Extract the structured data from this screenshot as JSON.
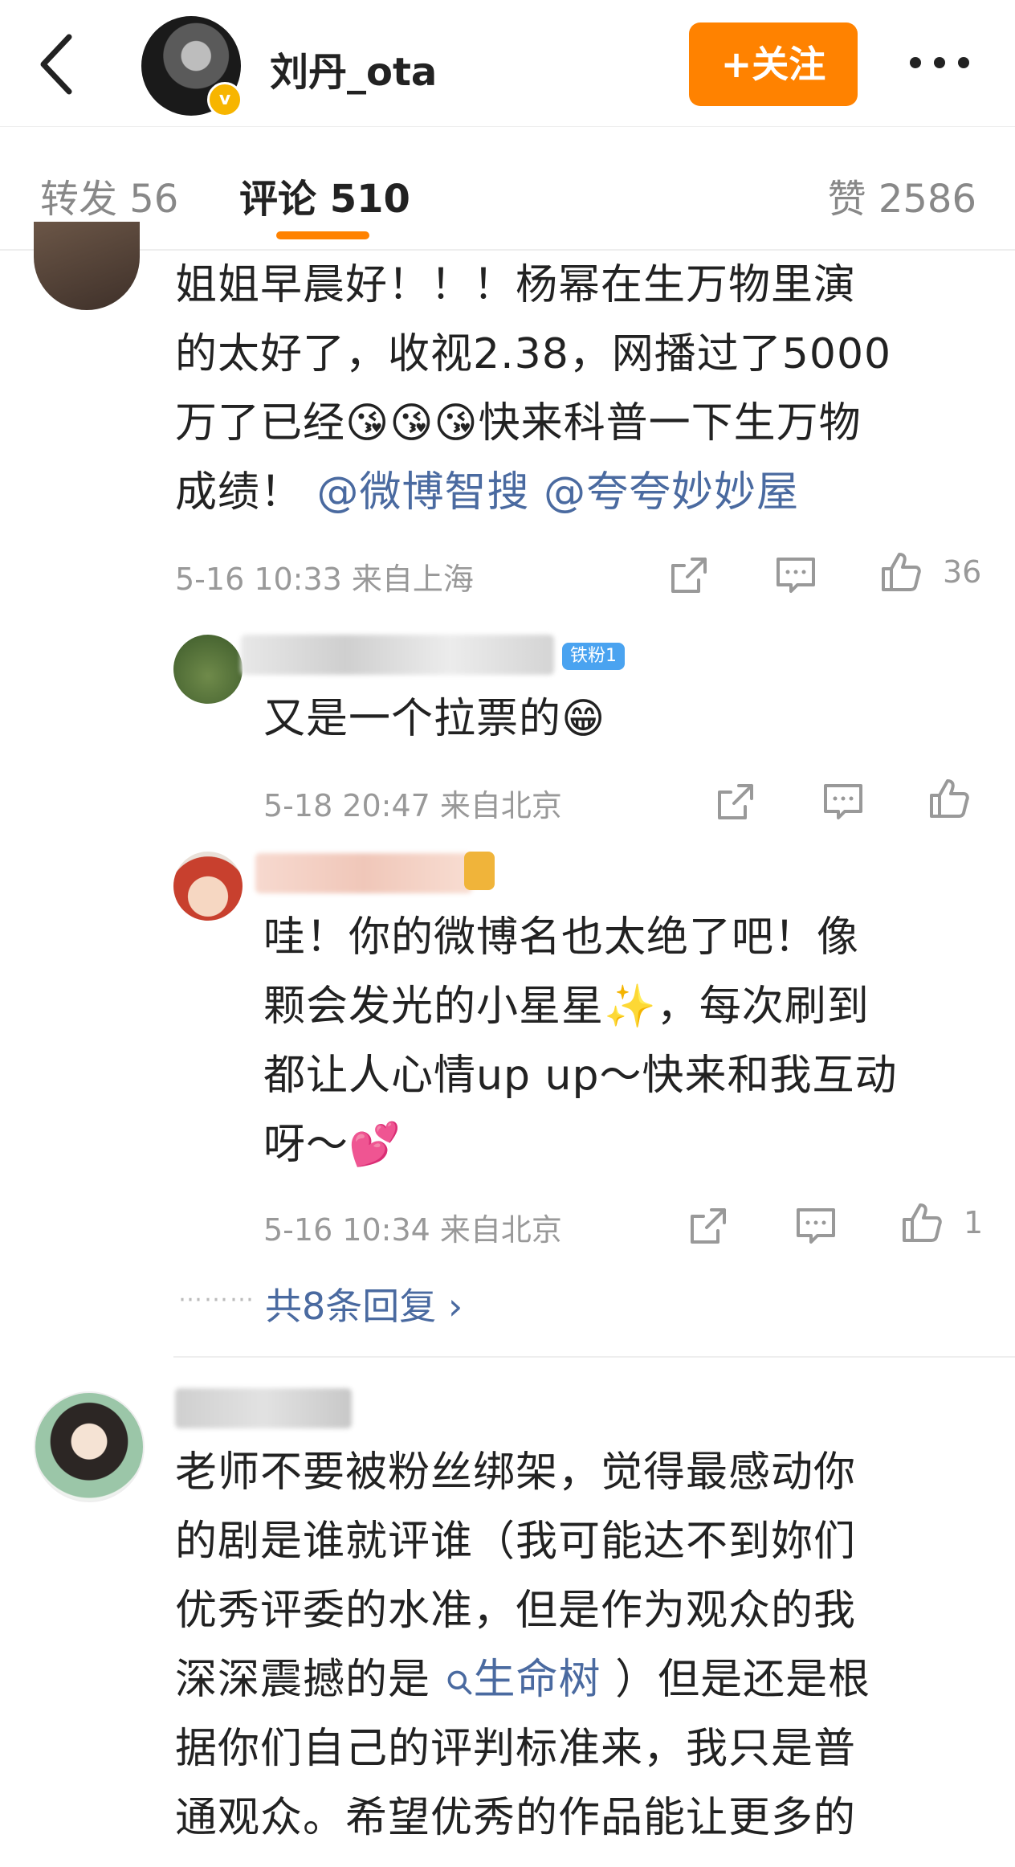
{
  "header": {
    "username": "刘丹_ota",
    "follow_label": "+关注",
    "verified_mark": "v"
  },
  "tabs": {
    "repost": "转发 56",
    "comments": "评论 510",
    "likes": "赞 2586"
  },
  "comments": [
    {
      "text_lines": [
        "姐姐早晨好！！！杨幂在生万物里演",
        "的太好了，收视2.38，网播过了5000",
        "万了已经😘😘😘快来科普一下生万物"
      ],
      "line4_prefix": "成绩！",
      "mention1": "@微博智搜",
      "mention2": "@夸夸妙妙屋",
      "meta": "5-16 10:33  来自上海",
      "likes": "36"
    },
    {
      "badge": "铁粉1",
      "text": "又是一个拉票的😁",
      "meta": "5-18 20:47  来自北京"
    },
    {
      "text_lines": [
        "哇！你的微博名也太绝了吧！像",
        "颗会发光的小星星✨，每次刷到",
        "都让人心情up up～快来和我互动",
        "呀～💕"
      ],
      "meta": "5-16 10:34  来自北京",
      "likes": "1"
    },
    {
      "text_lines": [
        "老师不要被粉丝绑架，觉得最感动你",
        "的剧是谁就评谁（我可能达不到妳们",
        "优秀评委的水准，但是作为观众的我"
      ],
      "line4_prefix": "深深震撼的是",
      "search_link": "生命树",
      "line4_suffix": "）但是还是根",
      "text_lines_after": [
        "据你们自己的评判标准来，我只是普",
        "通观众。希望优秀的作品能让更多的"
      ]
    }
  ],
  "more_replies": "共8条回复 ›",
  "dots": "⋯⋯⋯",
  "icons": [
    "back-icon",
    "more-icon",
    "share-icon",
    "comment-icon",
    "like-icon",
    "search-icon"
  ],
  "colors": {
    "accent": "#ff8200",
    "link": "#4a6aa0",
    "meta": "#999999"
  }
}
